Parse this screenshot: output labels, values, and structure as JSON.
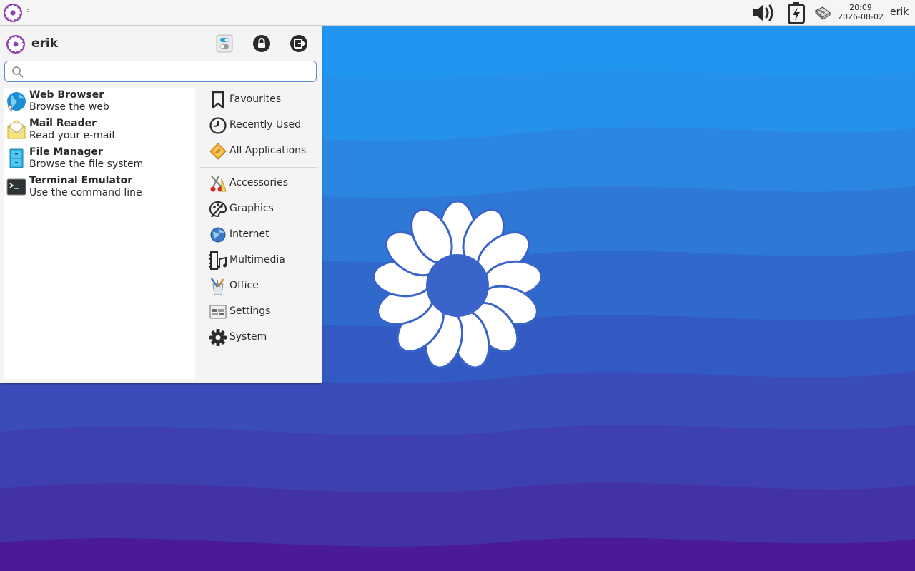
{
  "panel": {
    "clock_time": "20:09",
    "clock_date": "2026-08-02",
    "user": "erik",
    "icons": [
      "whisker-menu-icon",
      "volume-icon",
      "battery-charging-icon",
      "network-icon"
    ]
  },
  "menu": {
    "username": "erik",
    "header_icons": [
      "settings-manager-icon",
      "lock-screen-icon",
      "logout-icon"
    ],
    "search": {
      "value": "",
      "placeholder": ""
    },
    "favourites": [
      {
        "name": "Web Browser",
        "description": "Browse the web",
        "icon": "web-browser-icon"
      },
      {
        "name": "Mail Reader",
        "description": "Read your e-mail",
        "icon": "mail-reader-icon"
      },
      {
        "name": "File Manager",
        "description": "Browse the file system",
        "icon": "file-manager-icon"
      },
      {
        "name": "Terminal Emulator",
        "description": "Use the command line",
        "icon": "terminal-icon"
      }
    ],
    "categories": [
      {
        "label": "Favourites",
        "icon": "bookmark-icon"
      },
      {
        "label": "Recently Used",
        "icon": "clock-icon"
      },
      {
        "label": "All Applications",
        "icon": "all-applications-icon"
      },
      {
        "label": "Accessories",
        "icon": "accessories-icon"
      },
      {
        "label": "Graphics",
        "icon": "graphics-icon"
      },
      {
        "label": "Internet",
        "icon": "internet-icon"
      },
      {
        "label": "Multimedia",
        "icon": "multimedia-icon"
      },
      {
        "label": "Office",
        "icon": "office-icon"
      },
      {
        "label": "Settings",
        "icon": "settings-icon"
      },
      {
        "label": "System",
        "icon": "system-gear-icon"
      }
    ]
  },
  "colors": {
    "wallpaper_top": "#2196f0",
    "wallpaper_bottom": "#4a1a98",
    "accent": "#8e44ad",
    "panel_bg": "#f5f5f5"
  }
}
